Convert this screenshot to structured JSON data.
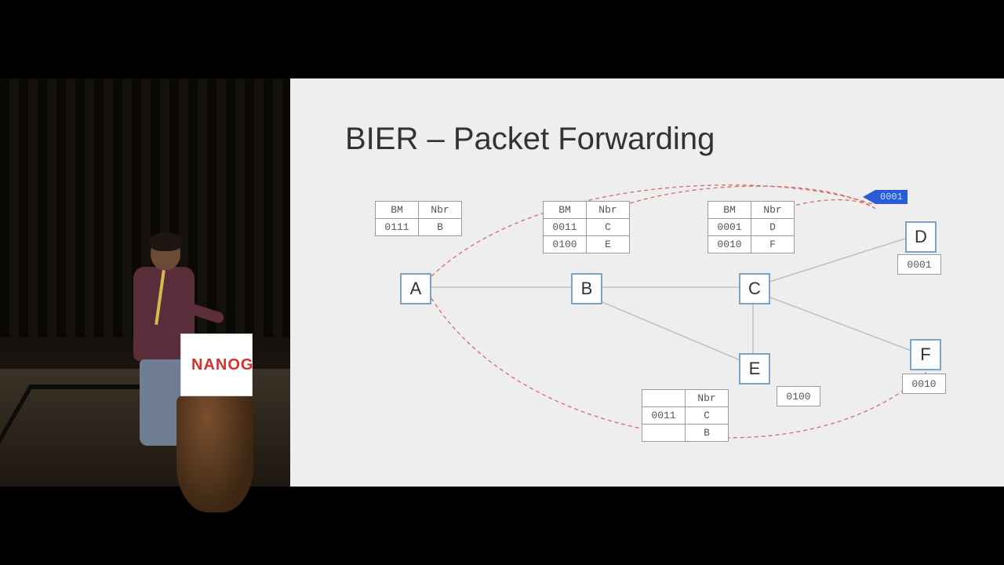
{
  "podium_logo": "NANOG",
  "slide": {
    "title": "BIER – Packet Forwarding",
    "packet": "0001",
    "nodes": {
      "A": "A",
      "B": "B",
      "C": "C",
      "D": "D",
      "E": "E",
      "F": "F"
    },
    "bits": {
      "D": "0001",
      "E": "0100",
      "F": "0010"
    },
    "tables": {
      "A": {
        "head": [
          "BM",
          "Nbr"
        ],
        "rows": [
          [
            "0111",
            "B"
          ]
        ]
      },
      "B": {
        "head": [
          "BM",
          "Nbr"
        ],
        "rows": [
          [
            "0011",
            "C"
          ],
          [
            "0100",
            "E"
          ]
        ]
      },
      "C": {
        "head": [
          "BM",
          "Nbr"
        ],
        "rows": [
          [
            "0001",
            "D"
          ],
          [
            "0010",
            "F"
          ]
        ]
      },
      "E": {
        "head": [
          "",
          "Nbr"
        ],
        "rows": [
          [
            "0011",
            "C"
          ],
          [
            "",
            "B"
          ]
        ]
      }
    }
  }
}
